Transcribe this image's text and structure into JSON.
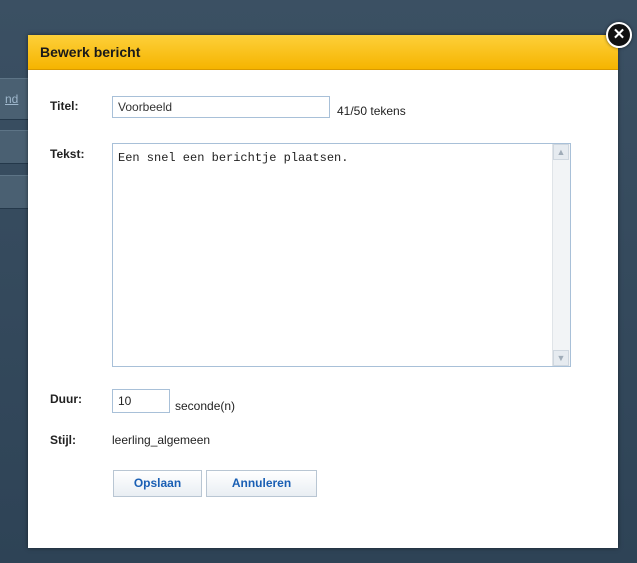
{
  "background": {
    "link_fragment": "nd"
  },
  "dialog": {
    "title": "Bewerk bericht",
    "close_glyph": "✕",
    "fields": {
      "title_label": "Titel:",
      "title_value": "Voorbeeld",
      "char_count": "41/50 tekens",
      "text_label": "Tekst:",
      "text_value": "Een snel een berichtje plaatsen.",
      "duration_label": "Duur:",
      "duration_value": "10",
      "duration_unit": "seconde(n)",
      "style_label": "Stijl:",
      "style_value": "leerling_algemeen"
    },
    "buttons": {
      "save": "Opslaan",
      "cancel": "Annuleren"
    }
  },
  "icons": {
    "close": "close-icon",
    "scroll_up": "chevron-up-icon",
    "scroll_down": "chevron-down-icon"
  },
  "colors": {
    "header": "#f6b400",
    "backdrop": "#2f4456",
    "button_text": "#1a5fb4",
    "input_border": "#a8c0d8"
  }
}
